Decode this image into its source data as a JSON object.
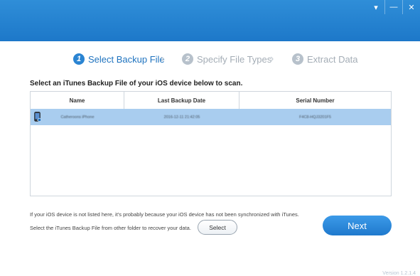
{
  "window": {
    "controls": [
      {
        "icon": "dropdown-arrow-icon",
        "glyph": "▾"
      },
      {
        "icon": "minimize-icon",
        "glyph": "—"
      },
      {
        "icon": "close-icon",
        "glyph": "✕"
      }
    ]
  },
  "steps": [
    {
      "number": "1",
      "label": "Select Backup File",
      "state": "active"
    },
    {
      "number": "2",
      "label": "Specify File Types",
      "state": "inactive"
    },
    {
      "number": "3",
      "label": "Extract Data",
      "state": "inactive"
    }
  ],
  "instruction": "Select an iTunes Backup File of your iOS device below to scan.",
  "table": {
    "columns": [
      "Name",
      "Last Backup Date",
      "Serial Number"
    ],
    "rows": [
      {
        "icon": "iphone-device-icon",
        "name": "Catheroons iPhone",
        "last_backup_date": "2016-12-11 21:42:05",
        "serial_number": "F4C8-HQJ3201F5"
      }
    ]
  },
  "notes": {
    "line1": "If your iOS device is not listed here, it's probably because your iOS device has not been synchronized with iTunes.",
    "line2": "Select the iTunes Backup File from other folder to recover your data."
  },
  "buttons": {
    "select": "Select",
    "next": "Next"
  },
  "version": "Version 1.2.1.4",
  "colors": {
    "header": "#1d78c9",
    "accent": "#2a84d2",
    "row_selected": "#a9cdef"
  }
}
